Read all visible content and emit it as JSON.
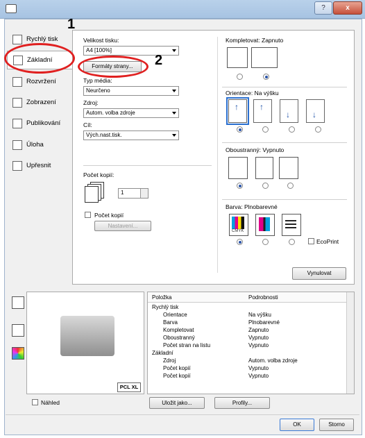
{
  "window": {
    "help_btn": "?",
    "close_btn": "x"
  },
  "callouts": {
    "one": "1",
    "two": "2"
  },
  "tabs": [
    {
      "label": "Rychlý tisk"
    },
    {
      "label": "Základní"
    },
    {
      "label": "Rozvržení"
    },
    {
      "label": "Zobrazení"
    },
    {
      "label": "Publikování"
    },
    {
      "label": "Úloha"
    },
    {
      "label": "Upřesnit"
    }
  ],
  "basic": {
    "print_size_label": "Velikost tisku:",
    "print_size_value": "A4 [100%]",
    "page_formats_button": "Formáty strany...",
    "media_type_label": "Typ média:",
    "media_type_value": "Neurčeno",
    "source_label": "Zdroj:",
    "source_value": "Autom. volba zdroje",
    "destination_label": "Cíl:",
    "destination_value": "Vých.nast.tisk.",
    "copies_label": "Počet kopií:",
    "copies_value": "1",
    "copies_check_label": "Počet kopií",
    "settings_button": "Nastavení..."
  },
  "collate": {
    "label": "Kompletovat:",
    "value": "Zapnuto"
  },
  "orientation": {
    "label": "Orientace:",
    "value": "Na výšku"
  },
  "duplex": {
    "label": "Oboustranný:",
    "value": "Vypnuto"
  },
  "color": {
    "label": "Barva:",
    "value": "Plnobarevné",
    "ecoprint_label": "EcoPrint",
    "cmyk_text": "CMYK"
  },
  "reset_button": "Vynulovat",
  "printer_badge": "PCL XL",
  "details": {
    "col_item": "Položka",
    "col_details": "Podrobnosti",
    "rows": [
      {
        "item": "Rychlý tisk",
        "value": "",
        "group": true
      },
      {
        "item": "Orientace",
        "value": "Na výšku",
        "group": false
      },
      {
        "item": "Barva",
        "value": "Plnobarevné",
        "group": false
      },
      {
        "item": "Kompletovat",
        "value": "Zapnuto",
        "group": false
      },
      {
        "item": "Oboustranný",
        "value": "Vypnuto",
        "group": false
      },
      {
        "item": "Počet stran na listu",
        "value": "Vypnuto",
        "group": false
      },
      {
        "item": "Základní",
        "value": "",
        "group": true
      },
      {
        "item": "Zdroj",
        "value": "Autom. volba zdroje",
        "group": false
      },
      {
        "item": "Počet kopií",
        "value": "Vypnuto",
        "group": false
      },
      {
        "item": "Počet kopií",
        "value": "Vypnuto",
        "group": false
      }
    ]
  },
  "preview_label": "Náhled",
  "save_as_button": "Uložit jako...",
  "profiles_button": "Profily...",
  "ok_button": "OK",
  "cancel_button": "Storno",
  "colors": {
    "accent": "#2a6fd0",
    "callout_red": "#e02020"
  }
}
